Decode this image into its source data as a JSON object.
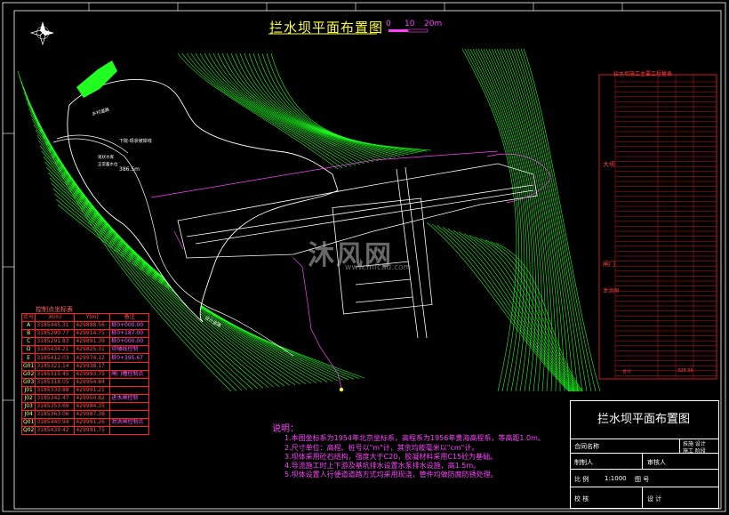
{
  "drawing": {
    "title": "拦水坝平面布置图",
    "scale_ticks": [
      "0",
      "10",
      "20m"
    ],
    "reservoir_label": "下院-现状坡岸线",
    "water_level_label1": "现状水库",
    "water_level_label2": "正常蓄水位",
    "water_level_value": "386.5m",
    "road_label": "乡村道路",
    "road_label2": "设计道路",
    "watermark_main": "沐风网",
    "watermark_sub": "www.mfcad.com"
  },
  "control_table": {
    "title": "控制点坐标表",
    "headers": [
      "点号",
      "X(m)",
      "Y(m)",
      "备注"
    ],
    "rows": [
      [
        "A",
        "3185445.31",
        "429888.56",
        "桩0+000.00"
      ],
      [
        "B",
        "3185290.77",
        "429914.75",
        "桩0+187.00"
      ],
      [
        "C",
        "3185291.83",
        "429891.39",
        "桩0+000.00"
      ],
      [
        "D",
        "3185434.21",
        "429825.31",
        "坝轴线控制"
      ],
      [
        "E",
        "3185412.03",
        "429974.12",
        "桩0+395.67"
      ],
      [
        "G01",
        "3185321.14",
        "429938.17",
        ""
      ],
      [
        "G02",
        "3185315.45",
        "429993.75",
        "闸门槽控制点"
      ],
      [
        "G03",
        "3185318.05",
        "429954.84",
        ""
      ],
      [
        "J01",
        "3185333.88",
        "429991.21",
        ""
      ],
      [
        "J02",
        "3185342.47",
        "429950.82",
        "进水闸控制"
      ],
      [
        "J03",
        "3185353.69",
        "429984.35",
        ""
      ],
      [
        "J04",
        "3185363.06",
        "429987.38",
        ""
      ],
      [
        "Q01",
        "3185440.94",
        "429991.26",
        "泄洪闸控制点"
      ],
      [
        "Q02",
        "3185439.42",
        "429991.75",
        ""
      ]
    ]
  },
  "engineering_table": {
    "title": "拦水坝施工主要工程量表",
    "section1": "大坝",
    "section2": "闸门",
    "section3": "泄洪闸",
    "total_label": "合计",
    "total_value": "328.36"
  },
  "notes": {
    "heading": "说明：",
    "items": [
      "1.本图坐标系为1954年北京坐标系，高程系为1956年黄海高程系，等高距1.0m。",
      "2.尺寸单位：高程、桩号以\"m\"计，其余均按毫米以\"cm\"计。",
      "3.坝体采用砼石结构，强度大于C20，胶凝材料采用C15砼为基础。",
      "4.导流施工时上下游及基坑排水设置水泵排水设施，高1.5m。",
      "5.坝体设置人行便道道路方式均采用现浇，管件均做防腐防锈处理。"
    ]
  },
  "title_block": {
    "title": "拦水坝平面布置图",
    "contract_label": "合同名称",
    "design_label": "技施 设计",
    "stage_label": "施工 阶段",
    "drawn_label": "制制人",
    "review_label": "审核人",
    "scale_label": "比 例",
    "scale_value": "1:1000",
    "sheet_label": "图 号",
    "check_label": "校 核",
    "design_person_label": "设 计"
  },
  "colors": {
    "background": "#000000",
    "contour": "#20ff20",
    "dam": "#ffffff",
    "annotation": "#ff40ff",
    "table_border": "#ff2020",
    "title": "#ffff40"
  }
}
